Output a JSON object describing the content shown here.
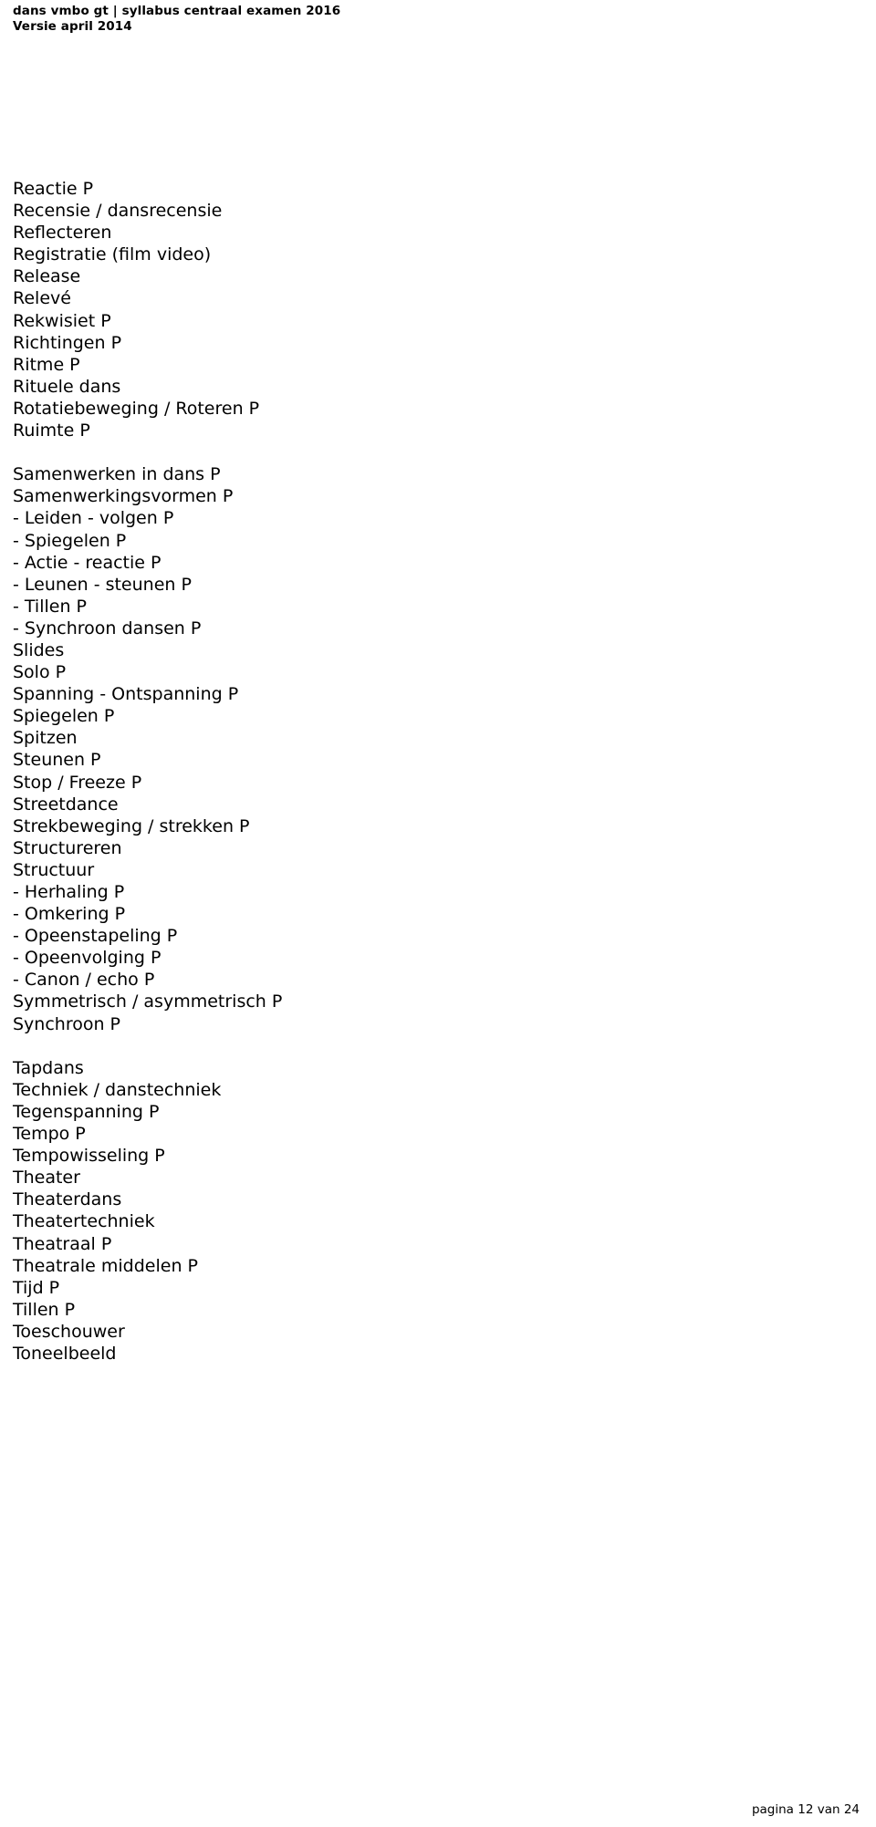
{
  "header": {
    "line1": "dans vmbo gt | syllabus centraal examen 2016",
    "line2": "Versie april 2014"
  },
  "content": {
    "terms": [
      "Reactie P",
      "Recensie / dansrecensie",
      "Reflecteren",
      "Registratie (film video)",
      "Release",
      "Relevé",
      "Rekwisiet P",
      "Richtingen P",
      "Ritme P",
      "Rituele dans",
      "Rotatiebeweging / Roteren P",
      "Ruimte P",
      "",
      "Samenwerken in dans P",
      "Samenwerkingsvormen P",
      "- Leiden - volgen P",
      "- Spiegelen P",
      "- Actie - reactie P",
      "- Leunen - steunen P",
      "- Tillen P",
      "- Synchroon dansen P",
      "Slides",
      "Solo P",
      "Spanning - Ontspanning P",
      "Spiegelen P",
      "Spitzen",
      "Steunen P",
      "Stop / Freeze P",
      "Streetdance",
      "Strekbeweging / strekken P",
      "Structureren",
      "Structuur",
      "- Herhaling P",
      "- Omkering P",
      "- Opeenstapeling P",
      "- Opeenvolging P",
      "- Canon / echo P",
      "Symmetrisch / asymmetrisch P",
      "Synchroon P",
      "",
      "Tapdans",
      "Techniek / danstechniek",
      "Tegenspanning P",
      "Tempo P",
      "Tempowisseling P",
      "Theater",
      "Theaterdans",
      "Theatertechniek",
      "Theatraal P",
      "Theatrale middelen P",
      "Tijd P",
      "Tillen P",
      "Toeschouwer",
      "Toneelbeeld"
    ]
  },
  "footer": {
    "page_label": "pagina 12 van 24"
  }
}
